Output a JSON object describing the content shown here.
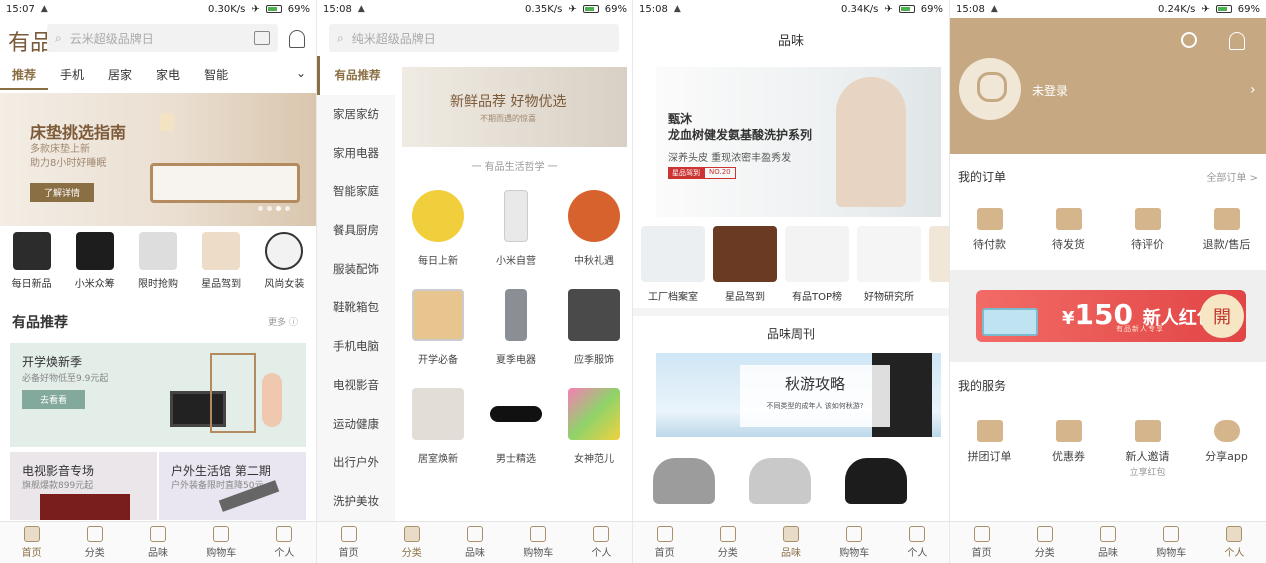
{
  "panel1": {
    "status": {
      "time": "15:07",
      "speed": "0.30K/s",
      "battery": "69%"
    },
    "logo": "有品",
    "search_placeholder": "云米超级品牌日",
    "categories": [
      "推荐",
      "手机",
      "居家",
      "家电",
      "智能"
    ],
    "banner": {
      "title": "床垫挑选指南",
      "sub1": "多款床垫上新",
      "sub2": "助力8小时好睡眠",
      "button": "了解详情"
    },
    "quick": [
      "每日新品",
      "小米众筹",
      "限时抢购",
      "星品驾到",
      "风尚女装"
    ],
    "section": {
      "title": "有品推荐",
      "more": "更多"
    },
    "card_main": {
      "title": "开学焕新季",
      "sub": "必备好物低至9.9元起",
      "button": "去看看"
    },
    "card_left": {
      "title": "电视影音专场",
      "sub": "旗舰爆款899元起"
    },
    "card_right": {
      "title": "户外生活馆 第二期",
      "sub": "户外装备限时直降50元"
    }
  },
  "panel2": {
    "status": {
      "time": "15:08",
      "speed": "0.35K/s",
      "battery": "69%"
    },
    "search_placeholder": "纯米超级品牌日",
    "sidebar": [
      "有品推荐",
      "家居家纺",
      "家用电器",
      "智能家庭",
      "餐具厨房",
      "服装配饰",
      "鞋靴箱包",
      "手机电脑",
      "电视影音",
      "运动健康",
      "出行户外",
      "洗护美妆"
    ],
    "banner": {
      "title": "新鲜品荐 好物优选",
      "sub": "不期而遇的惊喜"
    },
    "philosophy": "一  有品生活哲学  一",
    "grid": [
      "每日上新",
      "小米自营",
      "中秋礼遇",
      "开学必备",
      "夏季电器",
      "应季服饰",
      "居室焕新",
      "男士精选",
      "女神范儿"
    ]
  },
  "panel3": {
    "status": {
      "time": "15:08",
      "speed": "0.34K/s",
      "battery": "69%"
    },
    "header": "品味",
    "hero": {
      "brand": "甄沐",
      "title": "龙血树健发氨基酸洗护系列",
      "sub": "深养头皮  重现浓密丰盈秀发",
      "tag1": "星品驾到",
      "tag2": "NO.20"
    },
    "tiles": [
      "工厂档案室",
      "星品驾到",
      "有品TOP榜",
      "好物研究所",
      "品"
    ],
    "weekly": "品味周刊",
    "article": {
      "title": "秋游攻略",
      "sub": "不同类型的成年人 该如何秋游?"
    }
  },
  "panel4": {
    "status": {
      "time": "15:08",
      "speed": "0.24K/s",
      "battery": "69%"
    },
    "login": "未登录",
    "orders": {
      "title": "我的订单",
      "all": "全部订单 >",
      "items": [
        "待付款",
        "待发货",
        "待评价",
        "退款/售后"
      ]
    },
    "promo": {
      "amount": "150",
      "label": "新人红包",
      "sub": "有品新人专享",
      "open": "開",
      "currency": "¥"
    },
    "services": {
      "title": "我的服务",
      "items": [
        "拼团订单",
        "优惠券",
        "新人邀请",
        "分享app"
      ],
      "invite_sub": "立享红包"
    }
  },
  "tabs": [
    "首页",
    "分类",
    "品味",
    "购物车",
    "个人"
  ]
}
